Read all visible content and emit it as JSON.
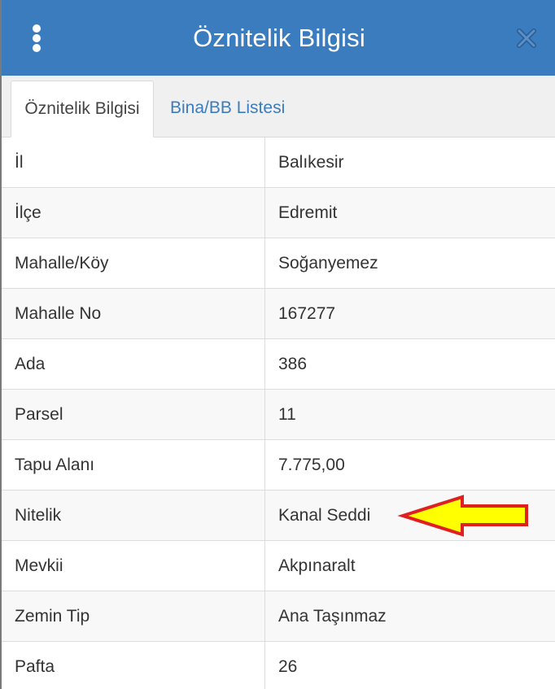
{
  "header": {
    "title": "Öznitelik Bilgisi",
    "menu_icon": "vertical-dots-icon",
    "close_icon": "close-x-icon",
    "background_color": "#3b7cbf"
  },
  "tabs": [
    {
      "label": "Öznitelik Bilgisi",
      "active": true
    },
    {
      "label": "Bina/BB Listesi",
      "active": false
    }
  ],
  "attributes": [
    {
      "label": "İl",
      "value": "Balıkesir"
    },
    {
      "label": "İlçe",
      "value": "Edremit"
    },
    {
      "label": "Mahalle/Köy",
      "value": "Soğanyemez"
    },
    {
      "label": "Mahalle No",
      "value": "167277"
    },
    {
      "label": "Ada",
      "value": "386"
    },
    {
      "label": "Parsel",
      "value": "11"
    },
    {
      "label": "Tapu Alanı",
      "value": "7.775,00"
    },
    {
      "label": "Nitelik",
      "value": "Kanal Seddi"
    },
    {
      "label": "Mevkii",
      "value": "Akpınaralt"
    },
    {
      "label": "Zemin Tip",
      "value": "Ana Taşınmaz"
    },
    {
      "label": "Pafta",
      "value": "26"
    }
  ],
  "annotation": {
    "icon": "left-arrow-icon",
    "fill_color": "#ffff00",
    "stroke_color": "#e02020"
  }
}
